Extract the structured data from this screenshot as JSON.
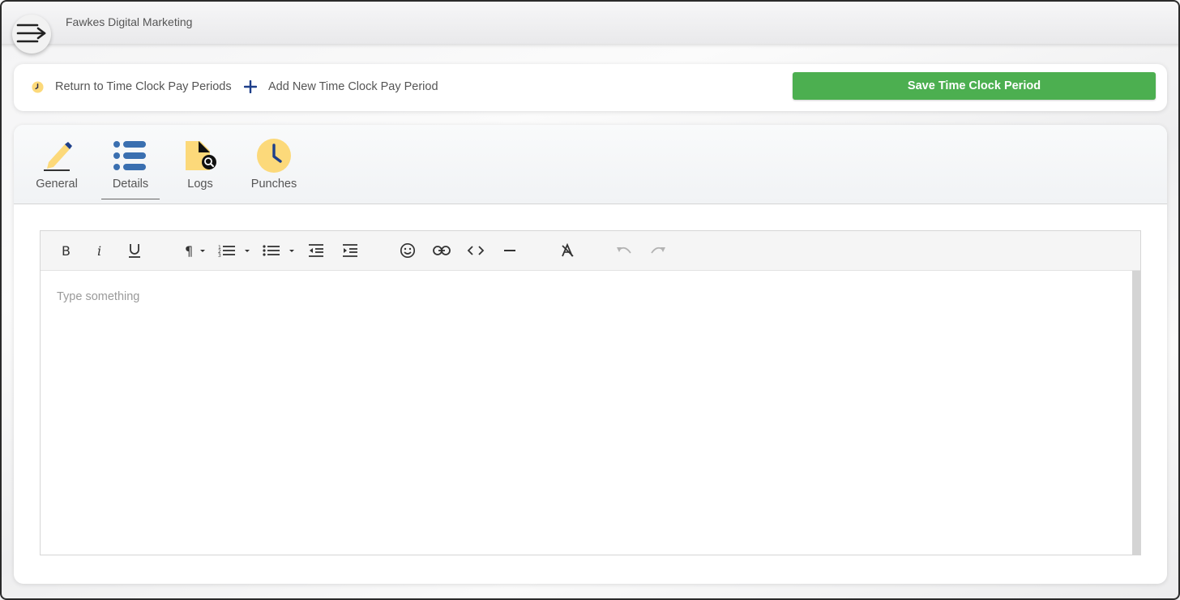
{
  "header": {
    "company": "Fawkes Digital Marketing",
    "menu_icon": "menu-arrow-icon"
  },
  "actions": {
    "return_label": "Return to Time Clock Pay Periods",
    "add_label": "Add New Time Clock Pay Period",
    "save_label": "Save Time Clock Period"
  },
  "tabs": [
    {
      "label": "General",
      "icon": "pencil-icon"
    },
    {
      "label": "Details",
      "icon": "list-icon"
    },
    {
      "label": "Logs",
      "icon": "file-search-icon"
    },
    {
      "label": "Punches",
      "icon": "clock-icon"
    }
  ],
  "active_tab": "Details",
  "editor": {
    "placeholder": "Type something",
    "toolbar": [
      "bold",
      "italic",
      "underline",
      "paragraph",
      "ordered-list",
      "unordered-list",
      "outdent",
      "indent",
      "emoji",
      "link",
      "code",
      "horizontal-rule",
      "clear-format",
      "undo",
      "redo"
    ]
  },
  "colors": {
    "save_button": "#4caf50",
    "accent_blue": "#3a6fb0",
    "icon_yellow": "#fcd97a"
  }
}
